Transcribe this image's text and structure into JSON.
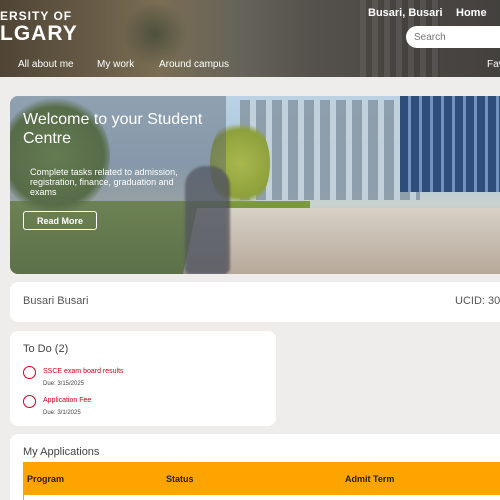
{
  "header": {
    "logo_line1": "ERSITY OF",
    "logo_line2": "LGARY",
    "user_name": "Busari, Busari",
    "home_label": "Home",
    "search_placeholder": "Search",
    "nav": [
      "All about me",
      "My work",
      "Around campus",
      "Fav"
    ]
  },
  "hero": {
    "title": "Welcome to your Student Centre",
    "text": "Complete tasks related to admission, registration, finance, graduation and exams",
    "button_label": "Read More"
  },
  "profile": {
    "name": "Busari Busari",
    "ucid": "UCID: 30"
  },
  "todo": {
    "title": "To Do (2)",
    "items": [
      {
        "label": "SSCE exam board results",
        "due": "Due: 3/15/2025"
      },
      {
        "label": "Application Fee",
        "due": "Due: 3/1/2025"
      }
    ]
  },
  "applications": {
    "title": "My Applications",
    "columns": [
      "Program",
      "Status",
      "Admit Term"
    ]
  },
  "colors": {
    "accent_red": "#d6001c",
    "table_header": "#fda400"
  }
}
